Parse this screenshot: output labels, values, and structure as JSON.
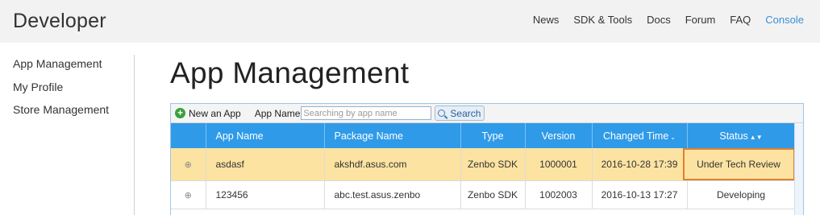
{
  "header": {
    "brand": "Developer",
    "nav": [
      "News",
      "SDK & Tools",
      "Docs",
      "Forum",
      "FAQ",
      "Console"
    ],
    "active_nav": "Console"
  },
  "sidebar": {
    "items": [
      "App Management",
      "My Profile",
      "Store Management"
    ]
  },
  "page": {
    "title": "App Management"
  },
  "toolbar": {
    "new_app_label": "New an App",
    "app_name_label": "App Name",
    "search_placeholder": "Searching by app name",
    "search_value": "",
    "search_button": "Search"
  },
  "table": {
    "columns": [
      "",
      "App Name",
      "Package Name",
      "Type",
      "Version",
      "Changed Time",
      "Status"
    ],
    "rows": [
      {
        "app_name": "asdasf",
        "package": "akshdf.asus.com",
        "type": "Zenbo SDK",
        "version": "1000001",
        "changed": "2016-10-28 17:39",
        "status": "Under Tech Review",
        "selected": true
      },
      {
        "app_name": "123456",
        "package": "abc.test.asus.zenbo",
        "type": "Zenbo SDK",
        "version": "1002003",
        "changed": "2016-10-13 17:27",
        "status": "Developing",
        "selected": false
      }
    ]
  },
  "icons": {
    "add": "plus-circle-icon",
    "search": "magnifier-icon",
    "expand": "expand-icon",
    "sort_desc": "chevron-down-icon",
    "sort_both": "sort-icon"
  },
  "colors": {
    "header_bg": "#f2f2f2",
    "accent": "#3a8fd8",
    "table_header": "#2f9ae8",
    "selected_row": "#fce3a2",
    "highlight_border": "#e0802c"
  }
}
